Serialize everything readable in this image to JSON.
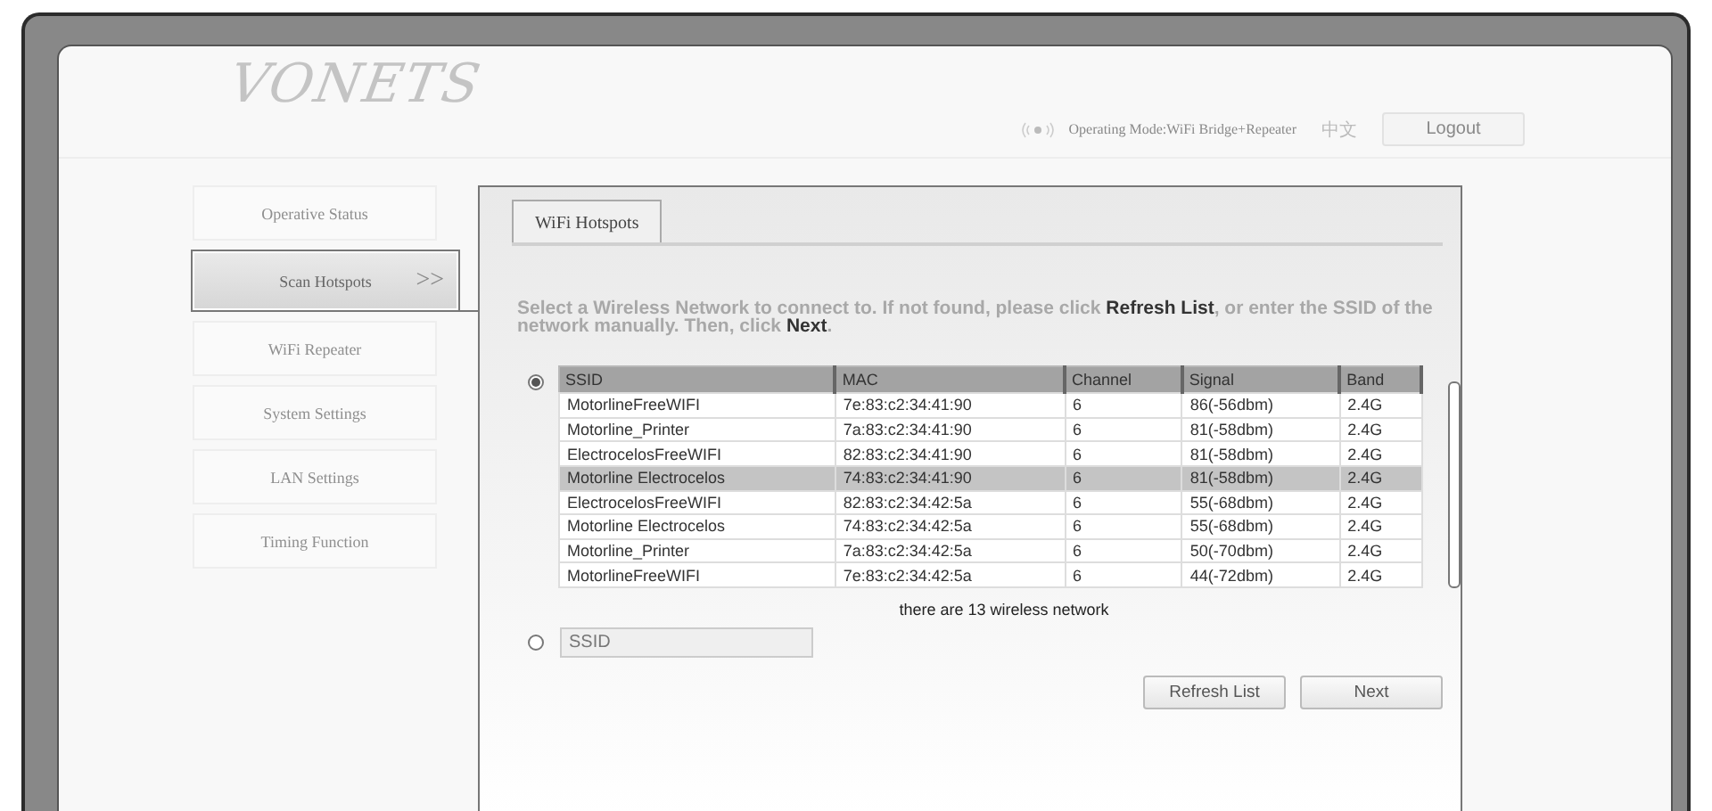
{
  "header": {
    "logo": "VONETS",
    "mode_label": "Operating Mode:",
    "mode_value": "WiFi Bridge+Repeater",
    "language": "中文",
    "logout": "Logout"
  },
  "sidebar": {
    "items": [
      {
        "label": "Operative Status",
        "selected": false
      },
      {
        "label": "Scan Hotspots",
        "selected": true,
        "arrow": ">>"
      },
      {
        "label": "WiFi Repeater",
        "selected": false
      },
      {
        "label": "System Settings",
        "selected": false
      },
      {
        "label": "LAN Settings",
        "selected": false
      },
      {
        "label": "Timing Function",
        "selected": false
      }
    ]
  },
  "panel": {
    "tab": "WiFi Hotspots",
    "instructions": "Select a Wireless Network to connect to. If not found, please click **Refresh List**, or enter the SSID of the network manually. Then, click **Next**.",
    "list_option": {
      "selected": true
    },
    "table": {
      "columns": [
        "SSID",
        "MAC",
        "Channel",
        "Signal",
        "Band"
      ],
      "rows": [
        {
          "cells": [
            "MotorlineFreeWIFI",
            "7e:83:c2:34:41:90",
            "6",
            "86(-56dbm)",
            "2.4G"
          ],
          "selected": false
        },
        {
          "cells": [
            "Motorline_Printer",
            "7a:83:c2:34:41:90",
            "6",
            "81(-58dbm)",
            "2.4G"
          ],
          "selected": false
        },
        {
          "cells": [
            "ElectrocelosFreeWIFI",
            "82:83:c2:34:41:90",
            "6",
            "81(-58dbm)",
            "2.4G"
          ],
          "selected": false
        },
        {
          "cells": [
            "Motorline Electrocelos",
            "74:83:c2:34:41:90",
            "6",
            "81(-58dbm)",
            "2.4G"
          ],
          "selected": true
        },
        {
          "cells": [
            "ElectrocelosFreeWIFI",
            "82:83:c2:34:42:5a",
            "6",
            "55(-68dbm)",
            "2.4G"
          ],
          "selected": false
        },
        {
          "cells": [
            "Motorline Electrocelos",
            "74:83:c2:34:42:5a",
            "6",
            "55(-68dbm)",
            "2.4G"
          ],
          "selected": false
        },
        {
          "cells": [
            "Motorline_Printer",
            "7a:83:c2:34:42:5a",
            "6",
            "50(-70dbm)",
            "2.4G"
          ],
          "selected": false
        },
        {
          "cells": [
            "MotorlineFreeWIFI",
            "7e:83:c2:34:42:5a",
            "6",
            "44(-72dbm)",
            "2.4G"
          ],
          "selected": false
        }
      ]
    },
    "count": "there are 13 wireless network",
    "manual_option": {
      "selected": false,
      "placeholder": "SSID"
    },
    "buttons": [
      "Refresh List",
      "Next"
    ]
  }
}
